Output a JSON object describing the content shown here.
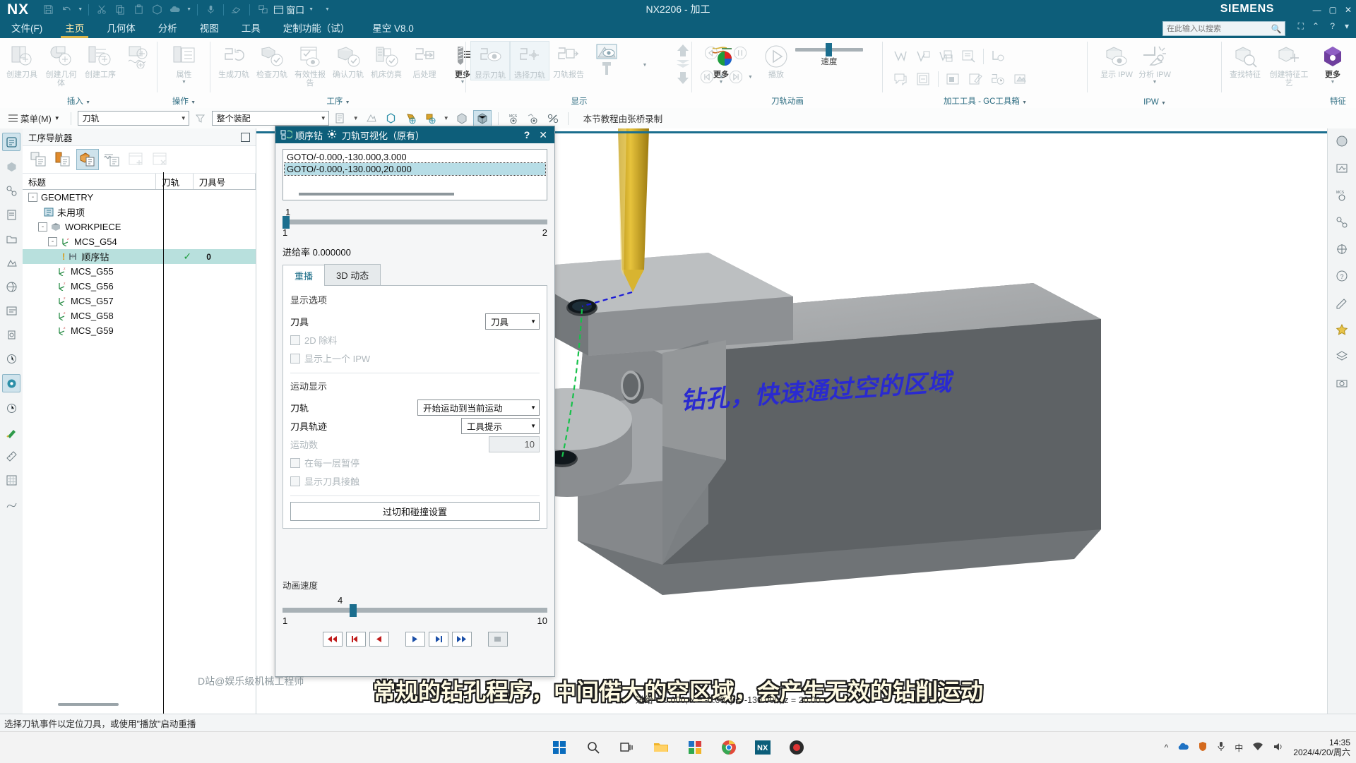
{
  "titlebar": {
    "logo": "NX",
    "app_title": "NX2206 - 加工",
    "brand": "SIEMENS",
    "window_label": "窗口",
    "qat_icons": [
      "save-icon",
      "undo-icon",
      "cut-icon",
      "copy-icon",
      "paste-icon",
      "paste-special-icon",
      "cloud-icon",
      "microphone-icon",
      "eraser-icon",
      "window-arrange-icon"
    ],
    "window_buttons": [
      "minimize",
      "maximize",
      "close"
    ]
  },
  "menubar": {
    "tabs": [
      {
        "label": "文件(F)",
        "active": false
      },
      {
        "label": "主页",
        "active": true
      },
      {
        "label": "几何体",
        "active": false
      },
      {
        "label": "分析",
        "active": false
      },
      {
        "label": "视图",
        "active": false
      },
      {
        "label": "工具",
        "active": false
      },
      {
        "label": "定制功能（试）",
        "active": false
      },
      {
        "label": "星空 V8.0",
        "active": false
      }
    ],
    "search_placeholder": "在此输入以搜索"
  },
  "ribbon": {
    "groups": [
      {
        "label": "插入",
        "items": [
          {
            "caption": "创建刀具",
            "icon": "create-tool-icon",
            "enabled": false
          },
          {
            "caption": "创建几何体",
            "icon": "create-geometry-icon",
            "enabled": false
          },
          {
            "caption": "创建工序",
            "icon": "create-operation-icon",
            "enabled": false
          },
          {
            "caption": "",
            "icon": "create-feature-icon",
            "enabled": false
          }
        ]
      },
      {
        "label": "操作",
        "items": [
          {
            "caption": "属性",
            "icon": "properties-icon",
            "enabled": false
          }
        ]
      },
      {
        "label": "工序",
        "items": [
          {
            "caption": "生成刀轨",
            "icon": "generate-toolpath-icon",
            "enabled": false
          },
          {
            "caption": "检查刀轨",
            "icon": "verify-toolpath-icon",
            "enabled": false
          },
          {
            "caption": "有效性报告",
            "icon": "validity-report-icon",
            "enabled": false
          },
          {
            "caption": "确认刀轨",
            "icon": "confirm-toolpath-icon",
            "enabled": false
          },
          {
            "caption": "机床仿真",
            "icon": "machine-simulation-icon",
            "enabled": false
          },
          {
            "caption": "后处理",
            "icon": "postprocess-icon",
            "enabled": false
          },
          {
            "caption": "更多",
            "icon": "more-drill-icon",
            "enabled": true
          }
        ]
      },
      {
        "label": "显示",
        "items": [
          {
            "caption": "显示刀轨",
            "icon": "show-toolpath-icon",
            "enabled": false
          },
          {
            "caption": "选择刀轨",
            "icon": "select-toolpath-icon",
            "enabled": false
          },
          {
            "caption": "刀轨报告",
            "icon": "toolpath-report-icon",
            "enabled": false
          },
          {
            "caption": "",
            "icon": "display-tool-icon",
            "enabled": false
          },
          {
            "caption": "",
            "icon": "cut-level-up-icon",
            "enabled": false
          },
          {
            "caption": "更多",
            "icon": "more-colorwheel-icon",
            "enabled": true
          }
        ]
      },
      {
        "label": "刀轨动画",
        "items": [
          {
            "caption": "",
            "icon": "step-back-icon",
            "enabled": false
          },
          {
            "caption": "",
            "icon": "pause-icon",
            "enabled": false
          },
          {
            "caption": "播放",
            "icon": "play-icon",
            "enabled": false
          },
          {
            "caption": "",
            "icon": "rewind-icon",
            "enabled": false
          },
          {
            "caption": "",
            "icon": "forward-icon",
            "enabled": false
          }
        ],
        "speed_label": "速度",
        "speed_value": 5
      },
      {
        "label": "加工工具 - GC工具箱",
        "items": [
          {
            "caption": "",
            "icon": "gc-tool-1-icon",
            "enabled": false
          },
          {
            "caption": "",
            "icon": "gc-tool-2-icon",
            "enabled": false
          },
          {
            "caption": "",
            "icon": "gc-tool-3-icon",
            "enabled": false
          },
          {
            "caption": "",
            "icon": "gc-tool-4-icon",
            "enabled": false
          },
          {
            "caption": "",
            "icon": "gc-tool-5-icon",
            "enabled": false
          },
          {
            "caption": "",
            "icon": "gc-tool-6-icon",
            "enabled": false
          },
          {
            "caption": "",
            "icon": "gc-tool-7-icon",
            "enabled": false
          },
          {
            "caption": "",
            "icon": "gc-tool-8-icon",
            "enabled": false
          },
          {
            "caption": "",
            "icon": "gc-tool-9-icon",
            "enabled": false
          },
          {
            "caption": "",
            "icon": "gc-tool-10-icon",
            "enabled": false
          },
          {
            "caption": "",
            "icon": "gc-tool-11-icon",
            "enabled": false
          }
        ]
      },
      {
        "label": "IPW",
        "items": [
          {
            "caption": "显示 IPW",
            "icon": "show-ipw-icon",
            "enabled": false
          },
          {
            "caption": "分析 IPW",
            "icon": "analyze-ipw-icon",
            "enabled": false
          }
        ]
      },
      {
        "label": "特征",
        "items": [
          {
            "caption": "查找特征",
            "icon": "find-feature-icon",
            "enabled": false
          },
          {
            "caption": "创建特征工艺",
            "icon": "create-feature-process-icon",
            "enabled": false
          },
          {
            "caption": "更多",
            "icon": "more-feature-icon",
            "enabled": true
          }
        ]
      }
    ]
  },
  "toolbar2": {
    "menu_label": "菜单(M)",
    "view_select": "刀轨",
    "assembly_select": "整个装配",
    "note": "本节教程由张桥录制",
    "icons": [
      "filter-icon",
      "part-icon",
      "snap-icon",
      "polygon-icon",
      "face-icon",
      "point-icon",
      "shade-icon",
      "shade-edges-icon",
      "mcs-icon",
      "wcs-icon",
      "no-display-icon"
    ]
  },
  "navigator": {
    "title": "工序导航器",
    "tool_buttons": [
      "program-order-view-icon",
      "machine-tool-view-icon",
      "geometry-view-icon",
      "machining-method-view-icon",
      "add-object-icon",
      "remove-object-icon"
    ],
    "columns": [
      "标题",
      "刀轨",
      "刀具号"
    ],
    "rows": [
      {
        "label": "GEOMETRY",
        "indent": 0,
        "toggle": "-",
        "icon": "",
        "path": "",
        "tool": "",
        "num": "",
        "selected": false
      },
      {
        "label": "未用项",
        "indent": 1,
        "toggle": "",
        "icon": "unused-items-icon",
        "tool": "",
        "num": "",
        "selected": false
      },
      {
        "label": "WORKPIECE",
        "indent": 1,
        "toggle": "-",
        "icon": "workpiece-icon",
        "tool": "",
        "num": "",
        "selected": false
      },
      {
        "label": "MCS_G54",
        "indent": 2,
        "toggle": "-",
        "icon": "mcs-icon",
        "tool": "",
        "num": "",
        "selected": false
      },
      {
        "label": "顺序钻",
        "indent": 3,
        "toggle": "",
        "icon": "drill-op-icon",
        "tool": "✓",
        "num": "0",
        "selected": true
      },
      {
        "label": "MCS_G55",
        "indent": 2,
        "toggle": "",
        "icon": "mcs-icon",
        "tool": "",
        "num": "",
        "selected": false
      },
      {
        "label": "MCS_G56",
        "indent": 2,
        "toggle": "",
        "icon": "mcs-icon",
        "tool": "",
        "num": "",
        "selected": false
      },
      {
        "label": "MCS_G57",
        "indent": 2,
        "toggle": "",
        "icon": "mcs-icon",
        "tool": "",
        "num": "",
        "selected": false
      },
      {
        "label": "MCS_G58",
        "indent": 2,
        "toggle": "",
        "icon": "mcs-icon",
        "tool": "",
        "num": "",
        "selected": false
      },
      {
        "label": "MCS_G59",
        "indent": 2,
        "toggle": "",
        "icon": "mcs-icon",
        "tool": "",
        "num": "",
        "selected": false
      }
    ]
  },
  "dialog": {
    "badge_label": "顺序钻",
    "title": "刀轨可视化（原有）",
    "help_label": "?",
    "close_label": "✕",
    "goto_lines": [
      {
        "text": "GOTO/-0.000,-130.000,3.000",
        "selected": false
      },
      {
        "text": "GOTO/-0.000,-130.000,20.000",
        "selected": true
      }
    ],
    "range": {
      "current": "1",
      "min": "1",
      "max": "2"
    },
    "feedrate": "进给率 0.000000",
    "tabs": [
      {
        "label": "重播",
        "active": true
      },
      {
        "label": "3D 动态",
        "active": false
      }
    ],
    "display_options_title": "显示选项",
    "tool_label": "刀具",
    "tool_value": "刀具",
    "checkbox_2d": "2D 除料",
    "checkbox_prev_ipw": "显示上一个 IPW",
    "motion_display_title": "运动显示",
    "toolpath_label": "刀轨",
    "toolpath_value": "开始运动到当前运动",
    "tooltrack_label": "刀具轨迹",
    "tooltrack_value": "工具提示",
    "motion_count_label": "运动数",
    "motion_count_value": "10",
    "pause_each_layer": "在每一层暂停",
    "show_tool_contact": "显示刀具接触",
    "gouge_button": "过切和碰撞设置",
    "anim_speed_label": "动画速度",
    "anim_speed_value": "4",
    "anim_speed_min": "1",
    "anim_speed_max": "10",
    "transport_buttons": [
      "rewind-to-start-icon",
      "step-back-icon",
      "play-back-icon",
      "play-forward-icon",
      "step-forward-icon",
      "forward-to-end-icon",
      "stop-icon"
    ]
  },
  "viewport": {
    "annotation": "钻孔，快速通过空的区域"
  },
  "status": {
    "message": "选择刀轨事件以定位刀具，或使用\"播放\"启动重播",
    "readout": "进给 = 0.000, x = -0.00, y = -130.000, z = 20.00",
    "watermark": "D站@娱乐级机械工程师",
    "subtitle": "常规的钻孔程序，中间偌大的空区域，会产生无效的钻削运动"
  },
  "taskbar": {
    "apps": [
      "windows-start-icon",
      "search-icon",
      "task-view-icon",
      "file-explorer-icon",
      "widgets-icon",
      "chrome-icon",
      "nx-icon",
      "record-icon"
    ],
    "tray": [
      "chevron-up-icon",
      "onedrive-icon",
      "shield-icon",
      "microphone-icon",
      "ime-cn-icon",
      "network-icon",
      "volume-icon"
    ],
    "time": "14:35",
    "date": "2024/4/20/周六"
  }
}
